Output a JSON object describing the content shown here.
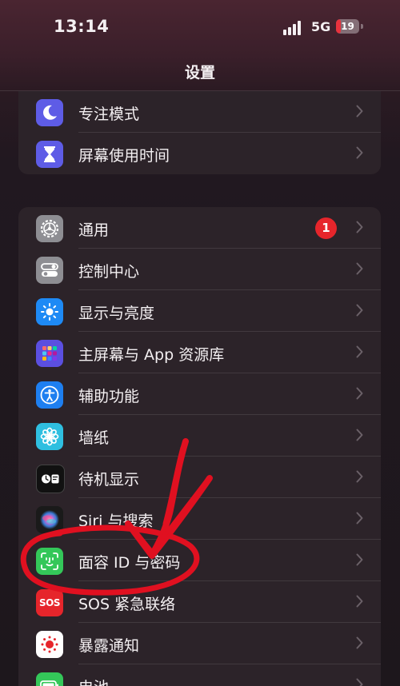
{
  "status_bar": {
    "time": "13:14",
    "network": "5G",
    "battery_level": "19",
    "battery_fraction": 0.19,
    "battery_color": "#e8323d"
  },
  "nav": {
    "title": "设置"
  },
  "group1": {
    "items": [
      {
        "label": "专注模式",
        "icon": "moon-icon",
        "icon_bg": "#5e5ce6"
      },
      {
        "label": "屏幕使用时间",
        "icon": "hourglass-icon",
        "icon_bg": "#5e5ce6"
      }
    ]
  },
  "group2": {
    "items": [
      {
        "label": "通用",
        "icon": "gear-icon",
        "icon_bg": "#8e8e93",
        "badge": "1"
      },
      {
        "label": "控制中心",
        "icon": "toggles-icon",
        "icon_bg": "#8e8e93"
      },
      {
        "label": "显示与亮度",
        "icon": "sun-icon",
        "icon_bg": "#1e8af5"
      },
      {
        "label": "主屏幕与 App 资源库",
        "icon": "app-grid-icon",
        "icon_bg": "#5b4fe0"
      },
      {
        "label": "辅助功能",
        "icon": "accessibility-icon",
        "icon_bg": "#1e7ff0"
      },
      {
        "label": "墙纸",
        "icon": "flower-icon",
        "icon_bg": "#2fbfe0"
      },
      {
        "label": "待机显示",
        "icon": "standby-icon",
        "icon_bg": "#111111"
      },
      {
        "label": "Siri 与搜索",
        "icon": "siri-icon",
        "icon_bg": "#1a1a1a"
      },
      {
        "label": "面容 ID 与密码",
        "icon": "face-id-icon",
        "icon_bg": "#34c759"
      },
      {
        "label": "SOS 紧急联络",
        "icon": "sos-icon",
        "icon_bg": "#e6252b",
        "icon_text": "SOS"
      },
      {
        "label": "暴露通知",
        "icon": "exposure-icon",
        "icon_bg": "#ffffff"
      },
      {
        "label": "电池",
        "icon": "battery-icon",
        "icon_bg": "#34c759"
      }
    ]
  },
  "annotation_color": "#e01020"
}
